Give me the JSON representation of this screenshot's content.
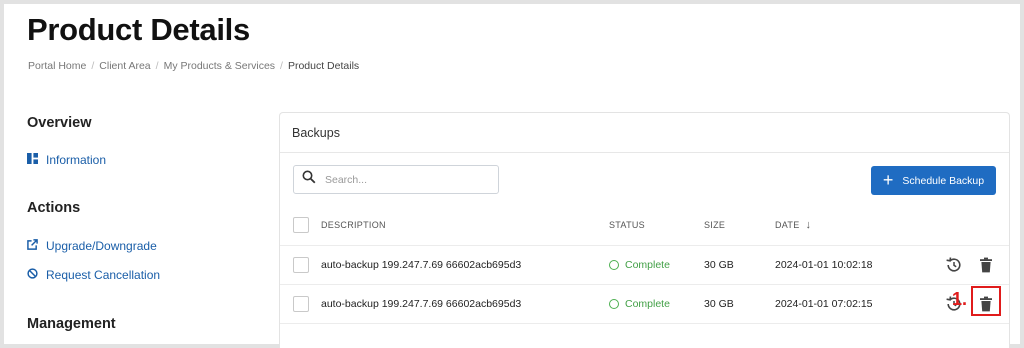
{
  "page": {
    "title": "Product Details",
    "breadcrumb": [
      "Portal Home",
      "Client Area",
      "My Products & Services",
      "Product Details"
    ]
  },
  "sidebar": {
    "overview_heading": "Overview",
    "overview_items": [
      {
        "label": "Information",
        "icon": "dashboard-icon"
      }
    ],
    "actions_heading": "Actions",
    "actions_items": [
      {
        "label": "Upgrade/Downgrade",
        "icon": "external-link-icon"
      },
      {
        "label": "Request Cancellation",
        "icon": "ban-icon"
      }
    ],
    "management_heading": "Management"
  },
  "backups": {
    "panel_title": "Backups",
    "search_placeholder": "Search...",
    "schedule_button": "Schedule Backup",
    "columns": {
      "description": "DESCRIPTION",
      "status": "STATUS",
      "size": "SIZE",
      "date": "DATE"
    },
    "date_sort": "descending",
    "rows": [
      {
        "description": "auto-backup 199.247.7.69 66602acb695d3",
        "status": "Complete",
        "size": "30 GB",
        "date": "2024-01-01 10:02:18"
      },
      {
        "description": "auto-backup 199.247.7.69 66602acb695d3",
        "status": "Complete",
        "size": "30 GB",
        "date": "2024-01-01 07:02:15"
      }
    ]
  },
  "annotation": {
    "label": "1.",
    "color": "#e01b1b"
  },
  "colors": {
    "accent": "#1f6cc2",
    "link": "#1a5ea8",
    "success": "#43a047"
  }
}
